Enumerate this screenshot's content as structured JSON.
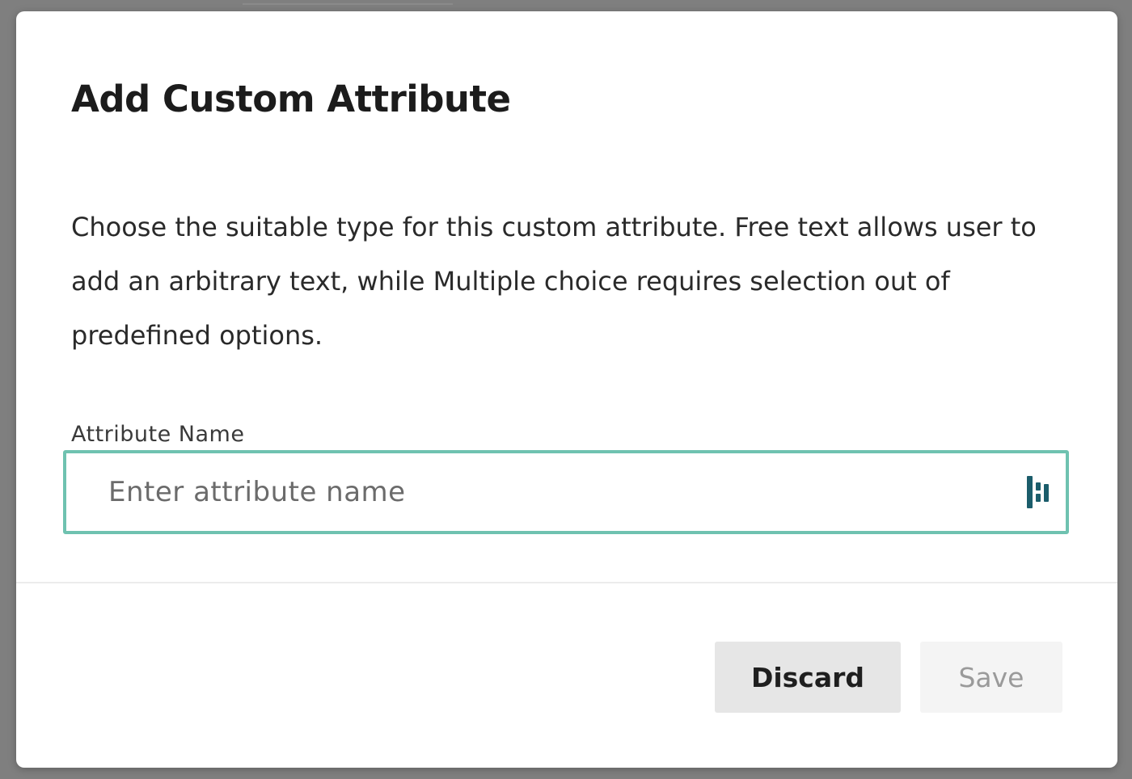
{
  "dialog": {
    "title": "Add Custom Attribute",
    "description": "Choose the suitable type for this custom attribute. Free text allows user to add an arbitrary text, while Multiple choice requires selection out of predefined options.",
    "field": {
      "label": "Attribute Name",
      "value": "",
      "placeholder": "Enter attribute name",
      "icon": "password-manager-icon"
    },
    "buttons": {
      "discard_label": "Discard",
      "save_label": "Save",
      "save_disabled": true
    }
  },
  "colors": {
    "focus_border": "#6fc2b0",
    "icon": "#1b5d6b",
    "discard_bg": "#e6e6e6",
    "save_bg": "#f4f4f4",
    "overlay": "#7f7f7f"
  }
}
